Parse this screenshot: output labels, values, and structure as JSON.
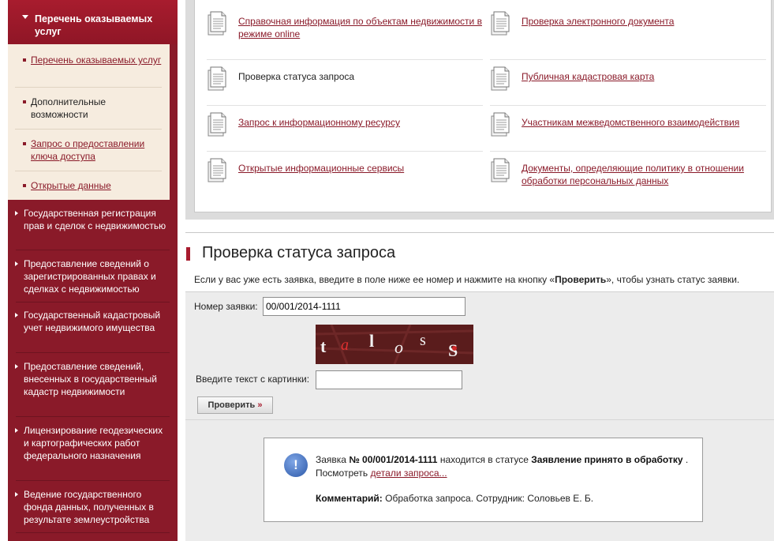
{
  "sidebar": {
    "header": "Перечень оказываемых услуг",
    "subitems": [
      {
        "label": "Перечень оказываемых услуг",
        "link": true
      },
      {
        "label": "Дополнительные возможности",
        "link": false
      },
      {
        "label": "Запрос о предоставлении ключа доступа",
        "link": true
      },
      {
        "label": "Открытые данные",
        "link": true
      }
    ],
    "nav": [
      "Государственная регистрация прав и сделок с недвижимостью",
      "Предоставление сведений о зарегистрированных правах и сделках с недвижимостью",
      "Государственный кадастровый учет недвижимого имущества",
      "Предоставление сведений, внесенных в государственный кадастр недвижимости",
      "Лицензирование геодезических и картографических работ федерального назначения",
      "Ведение государственного фонда данных, полученных в результате землеустройства"
    ]
  },
  "services": {
    "left": [
      {
        "label": "Справочная информация по объектам недвижимости в режиме online",
        "link": true
      },
      {
        "label": "Проверка статуса запроса",
        "link": false
      },
      {
        "label": "Запрос к информационному ресурсу",
        "link": true
      },
      {
        "label": "Открытые информационные сервисы",
        "link": true
      }
    ],
    "right": [
      {
        "label": "Проверка электронного документа",
        "link": true
      },
      {
        "label": "Публичная кадастровая карта",
        "link": true
      },
      {
        "label": "Участникам межведомственного взаимодействия",
        "link": true
      },
      {
        "label": "Документы, определяющие политику в отношении обработки персональных данных",
        "link": true
      }
    ]
  },
  "status_check": {
    "title": "Проверка статуса запроса",
    "intro_before": "Если у вас уже есть заявка, введите в поле ниже ее номер и нажмите на кнопку «",
    "intro_bold": "Проверить",
    "intro_after": "», чтобы узнать статус заявки.",
    "request_label": "Номер заявки:",
    "request_value": "00/001/2014-1111",
    "captcha_text": "talosS",
    "captcha_label": "Введите текст с картинки:",
    "captcha_value": "",
    "button_label": "Проверить",
    "button_arrow": "»"
  },
  "result": {
    "prefix": "Заявка ",
    "number": "№ 00/001/2014-1111",
    "middle": " находится в статусе ",
    "status": "Заявление принято в обработку",
    "end": " .",
    "view_prefix": "Посмотреть ",
    "details_link": "детали запроса...",
    "comment_label": "Комментарий:",
    "comment_text": " Обработка запроса. Сотрудник: Соловьев Е. Б."
  },
  "colors": {
    "accent": "#8a1a29",
    "sidebar": "#8a1a29",
    "subpanel": "#f6ecdf"
  },
  "icons": {
    "service": "document-icon",
    "info": "info-exclamation-icon"
  }
}
